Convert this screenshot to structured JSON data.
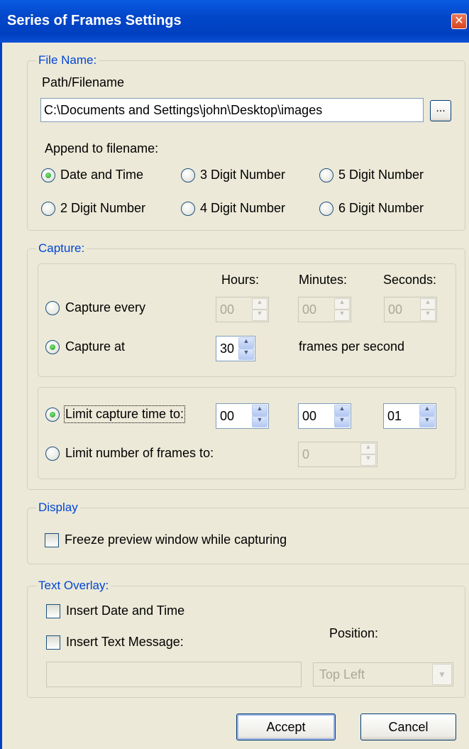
{
  "window": {
    "title": "Series of Frames Settings",
    "close_glyph": "✕"
  },
  "file_name": {
    "legend": "File Name:",
    "path_label": "Path/Filename",
    "path_value": "C:\\Documents and Settings\\john\\Desktop\\images",
    "browse_label": "...",
    "append_label": "Append to filename:",
    "options": [
      {
        "label": "Date and Time",
        "checked": true
      },
      {
        "label": "3 Digit Number",
        "checked": false
      },
      {
        "label": "5 Digit Number",
        "checked": false
      },
      {
        "label": "2 Digit Number",
        "checked": false
      },
      {
        "label": "4 Digit Number",
        "checked": false
      },
      {
        "label": "6 Digit Number",
        "checked": false
      }
    ]
  },
  "capture": {
    "legend": "Capture:",
    "hours_label": "Hours:",
    "minutes_label": "Minutes:",
    "seconds_label": "Seconds:",
    "capture_every_label": "Capture every",
    "every_hours": "00",
    "every_minutes": "00",
    "every_seconds": "00",
    "capture_at_label": "Capture at",
    "fps_value": "30",
    "fps_label": "frames per second",
    "limit_time_label": "Limit capture time to:",
    "limit_hours": "00",
    "limit_minutes": "00",
    "limit_seconds": "01",
    "limit_frames_label": "Limit number of frames to:",
    "limit_frames_value": "0"
  },
  "display": {
    "legend": "Display",
    "freeze_label": "Freeze preview window while capturing"
  },
  "overlay": {
    "legend": "Text Overlay:",
    "insert_date_label": "Insert Date and Time",
    "insert_text_label": "Insert Text Message:",
    "position_label": "Position:",
    "message_value": "",
    "position_value": "Top Left"
  },
  "buttons": {
    "accept": "Accept",
    "cancel": "Cancel"
  },
  "icons": {
    "spin_up": "▲",
    "spin_down": "▼",
    "dropdown": "▼"
  }
}
